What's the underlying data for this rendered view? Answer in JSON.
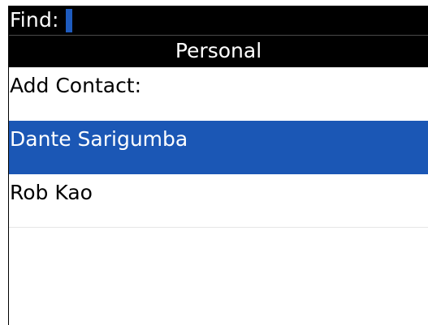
{
  "find": {
    "label": "Find:",
    "value": ""
  },
  "group": {
    "header": "Personal"
  },
  "contacts": {
    "items": [
      {
        "label": "Add Contact:"
      },
      {
        "label": "Dante Sarigumba"
      },
      {
        "label": "Rob Kao"
      }
    ],
    "selected_index": 1
  },
  "colors": {
    "selection": "#1b57b5",
    "cursor": "#1e5bbf",
    "header_bg": "#000000"
  }
}
